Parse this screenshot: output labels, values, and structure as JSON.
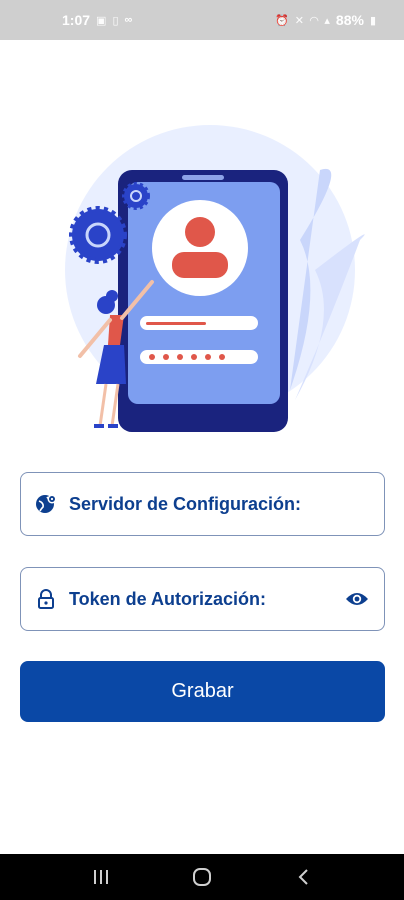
{
  "status_bar": {
    "time": "1:07",
    "battery": "88%"
  },
  "form": {
    "server_label": "Servidor de Configuración:",
    "token_label": "Token de Autorización:",
    "save_label": "Grabar"
  },
  "icons": {
    "server": "globe-gear-icon",
    "token": "lock-icon",
    "visibility": "eye-icon"
  },
  "colors": {
    "primary": "#0a48a6",
    "label": "#0d3f8f",
    "field_border": "#7f93b8"
  }
}
